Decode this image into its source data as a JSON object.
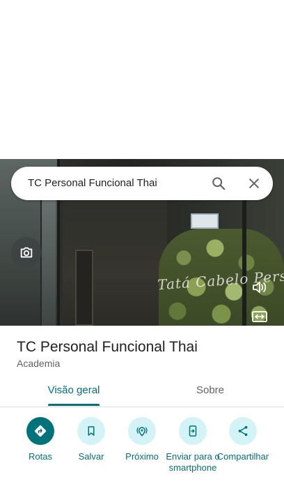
{
  "search": {
    "query": "TC Personal Funcional Thai"
  },
  "photo": {
    "watermark_text": "Tatá Cabelo Personal"
  },
  "place": {
    "name": "TC Personal Funcional Thai",
    "category": "Academia"
  },
  "tabs": [
    {
      "label": "Visão geral",
      "active": true
    },
    {
      "label": "Sobre",
      "active": false
    }
  ],
  "actions": [
    {
      "label": "Rotas",
      "icon": "directions-icon"
    },
    {
      "label": "Salvar",
      "icon": "bookmark-icon"
    },
    {
      "label": "Próximo",
      "icon": "nearby-icon"
    },
    {
      "label": "Enviar para o smartphone",
      "icon": "send-to-phone-icon"
    },
    {
      "label": "Compartilhar",
      "icon": "share-icon"
    }
  ],
  "colors": {
    "accent": "#00737a",
    "action_bg": "#d3f3f6"
  }
}
